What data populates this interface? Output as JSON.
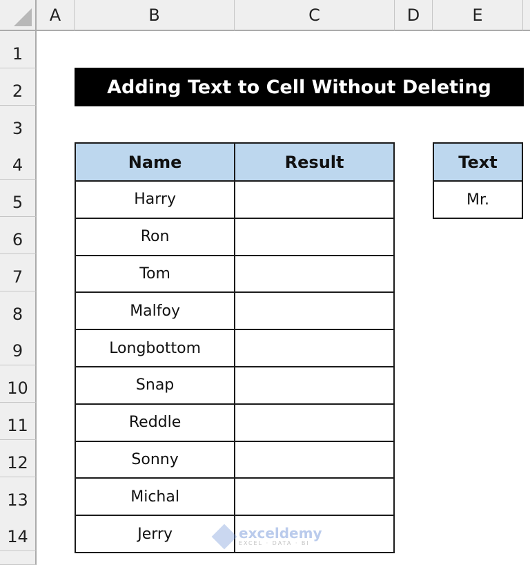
{
  "sheet": {
    "columns": [
      "A",
      "B",
      "C",
      "D",
      "E"
    ],
    "rows": [
      "1",
      "2",
      "3",
      "4",
      "5",
      "6",
      "7",
      "8",
      "9",
      "10",
      "11",
      "12",
      "13",
      "14"
    ]
  },
  "title": "Adding Text to Cell Without Deleting",
  "main_table": {
    "headers": [
      "Name",
      "Result"
    ],
    "rows": [
      {
        "name": "Harry",
        "result": ""
      },
      {
        "name": "Ron",
        "result": ""
      },
      {
        "name": "Tom",
        "result": ""
      },
      {
        "name": "Malfoy",
        "result": ""
      },
      {
        "name": "Longbottom",
        "result": ""
      },
      {
        "name": "Snap",
        "result": ""
      },
      {
        "name": "Reddle",
        "result": ""
      },
      {
        "name": "Sonny",
        "result": ""
      },
      {
        "name": "Michal",
        "result": ""
      },
      {
        "name": "Jerry",
        "result": ""
      }
    ]
  },
  "text_table": {
    "header": "Text",
    "value": "Mr."
  },
  "watermark": {
    "brand": "exceldemy",
    "tagline": "EXCEL · DATA · BI"
  },
  "colors": {
    "header_fill": "#bdd7ee",
    "title_fill": "#000000",
    "title_text": "#ffffff"
  }
}
